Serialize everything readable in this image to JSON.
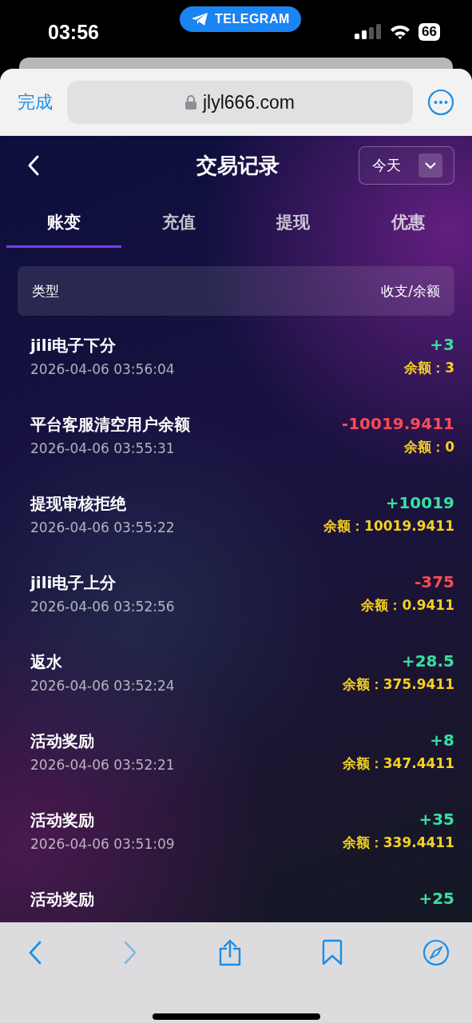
{
  "status_bar": {
    "time": "03:56",
    "app_badge": "TELEGRAM",
    "battery": "66"
  },
  "browser": {
    "done": "完成",
    "url": "jlyl666.com"
  },
  "header": {
    "title": "交易记录",
    "period": "今天"
  },
  "tabs": [
    {
      "label": "账变",
      "selected": true
    },
    {
      "label": "充值",
      "selected": false
    },
    {
      "label": "提现",
      "selected": false
    },
    {
      "label": "优惠",
      "selected": false
    }
  ],
  "table": {
    "columns": [
      "类型",
      "收支/余额"
    ],
    "rows": [
      {
        "type": "jili电子下分",
        "time": "2026-04-06 03:56:04",
        "amount": "+3",
        "kind": "credit",
        "balance": "余额：3"
      },
      {
        "type": "平台客服清空用户余额",
        "time": "2026-04-06 03:55:31",
        "amount": "-10019.9411",
        "kind": "debit",
        "balance": "余额：0"
      },
      {
        "type": "提现审核拒绝",
        "time": "2026-04-06 03:55:22",
        "amount": "+10019",
        "kind": "credit",
        "balance": "余额：10019.9411"
      },
      {
        "type": "jili电子上分",
        "time": "2026-04-06 03:52:56",
        "amount": "-375",
        "kind": "debit",
        "balance": "余额：0.9411"
      },
      {
        "type": "返水",
        "time": "2026-04-06 03:52:24",
        "amount": "+28.5",
        "kind": "credit",
        "balance": "余额：375.9411"
      },
      {
        "type": "活动奖励",
        "time": "2026-04-06 03:52:21",
        "amount": "+8",
        "kind": "credit",
        "balance": "余额：347.4411"
      },
      {
        "type": "活动奖励",
        "time": "2026-04-06 03:51:09",
        "amount": "+35",
        "kind": "credit",
        "balance": "余额：339.4411"
      },
      {
        "type": "活动奖励",
        "amount": "+25",
        "kind": "credit"
      }
    ]
  },
  "toolbar": {
    "back_disabled": false,
    "forward_disabled": true
  }
}
